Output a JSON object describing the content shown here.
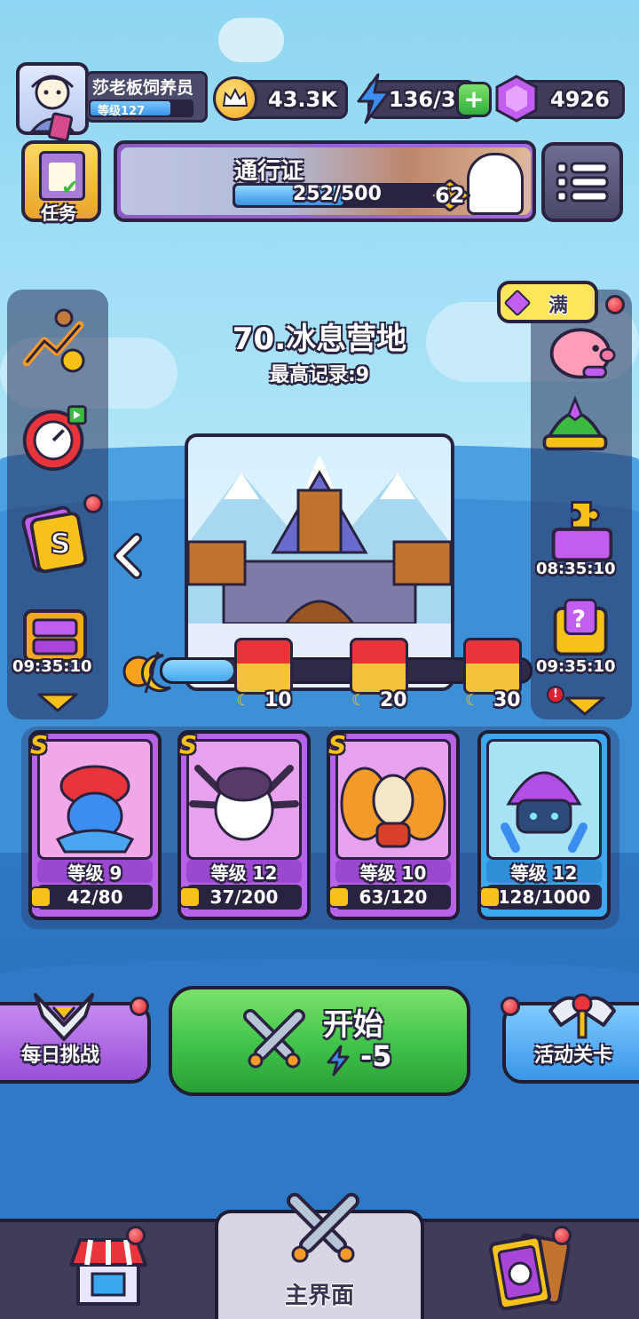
{
  "player": {
    "name": "莎老板饲养员",
    "level_label": "等级127"
  },
  "resources": {
    "crowns": "43.3K",
    "energy": "136/30",
    "gems": "4926"
  },
  "quests": {
    "label": "任务"
  },
  "pass": {
    "title": "通行证",
    "progress": "252/500",
    "progress_ratio": 0.504,
    "level": "62"
  },
  "piggy": {
    "label": "满"
  },
  "stage": {
    "title": "70.冰息营地",
    "record": "最高记录:9"
  },
  "timers": {
    "left": "09:35:10",
    "right_top": "08:35:10",
    "right_bottom": "09:35:10"
  },
  "chests": [
    {
      "label": "10"
    },
    {
      "label": "20"
    },
    {
      "label": "30"
    }
  ],
  "heroes": [
    {
      "rank": "S",
      "level": "等级 9",
      "shards": "42/80",
      "theme": "purple"
    },
    {
      "rank": "S",
      "level": "等级 12",
      "shards": "37/200",
      "theme": "purple"
    },
    {
      "rank": "S",
      "level": "等级 10",
      "shards": "63/120",
      "theme": "purple"
    },
    {
      "rank": "",
      "level": "等级 12",
      "shards": "128/1000",
      "theme": "blue"
    }
  ],
  "actions": {
    "daily": "每日挑战",
    "start": "开始",
    "start_cost": "-5",
    "event": "活动关卡"
  },
  "nav": {
    "home": "主界面"
  },
  "colors": {
    "green_button": "#3fc24a",
    "purple_card": "#b763e8",
    "blue_card": "#3aa7ee",
    "gold": "#f6c21a"
  }
}
